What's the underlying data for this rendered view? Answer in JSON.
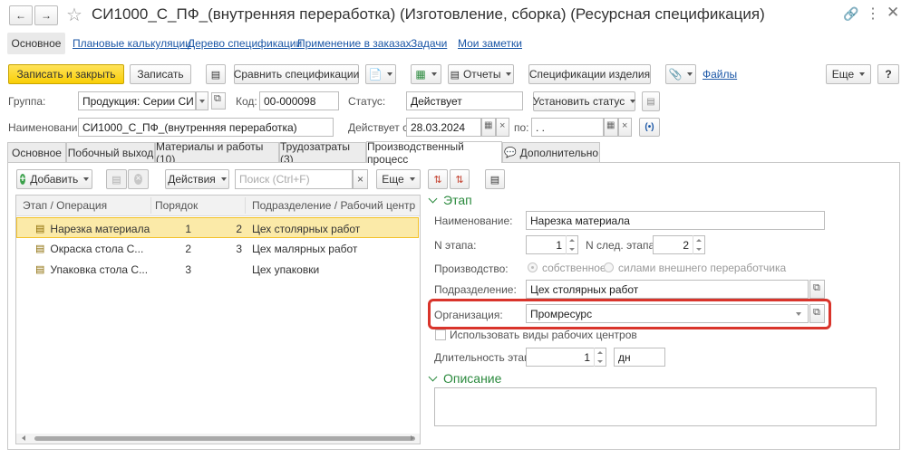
{
  "window": {
    "title": "СИ1000_С_ПФ_(внутренняя переработка) (Изготовление, сборка) (Ресурсная спецификация)"
  },
  "nav": {
    "items": [
      "Основное",
      "Плановые калькуляции",
      "Дерево спецификации",
      "Применение в заказах",
      "Задачи",
      "Мои заметки"
    ]
  },
  "toolbar": {
    "save_close": "Записать и закрыть",
    "save": "Записать",
    "compare": "Сравнить спецификации",
    "reports": "Отчеты",
    "specs_product": "Спецификации изделия",
    "files": "Файлы",
    "more": "Еще",
    "help": "?"
  },
  "header": {
    "group_label": "Группа:",
    "group_value": "Продукция: Серии СИ и Т",
    "code_label": "Код:",
    "code_value": "00-000098",
    "status_label": "Статус:",
    "status_value": "Действует",
    "set_status": "Установить статус",
    "name_label": "Наименование:",
    "name_value": "СИ1000_С_ПФ_(внутренняя переработка)",
    "valid_from_label": "Действует с:",
    "valid_from_value": "28.03.2024",
    "to_label": "по:",
    "to_value": " .  .",
    "range_icon_text": "(•)"
  },
  "tabs": [
    "Основное",
    "Побочный выход",
    "Материалы и работы (10)",
    "Трудозатраты (3)",
    "Производственный процесс",
    "Дополнительно"
  ],
  "stage_toolbar": {
    "add": "Добавить",
    "actions": "Действия",
    "search_placeholder": "Поиск (Ctrl+F)",
    "clear": "×",
    "more": "Еще"
  },
  "table": {
    "columns": [
      "Этап / Операция",
      "Порядок",
      "Подразделение / Рабочий центр"
    ],
    "rows": [
      {
        "stage": "Нарезка материала",
        "order": "1",
        "next": "2",
        "dept": "Цех столярных работ"
      },
      {
        "stage": "Окраска стола С...",
        "order": "2",
        "next": "3",
        "dept": "Цех малярных работ"
      },
      {
        "stage": "Упаковка стола С...",
        "order": "3",
        "next": "",
        "dept": "Цех упаковки"
      }
    ]
  },
  "stage_panel": {
    "section_title": "Этап",
    "name_label": "Наименование:",
    "name_value": "Нарезка материала",
    "n_label": "N этапа:",
    "n_value": "1",
    "next_label": "N след. этапа:",
    "next_value": "2",
    "production_label": "Производство:",
    "option_own": "собственное",
    "option_external": "силами внешнего переработчика",
    "dept_label": "Подразделение:",
    "dept_value": "Цех столярных работ",
    "org_label": "Организация:",
    "org_value": "Промресурс",
    "use_wc_types": "Использовать виды рабочих центров",
    "duration_label": "Длительность этапа:",
    "duration_value": "1",
    "duration_unit": "дн",
    "description_title": "Описание"
  },
  "colors": {
    "accent_yellow": "#f9d93b",
    "row_selected": "#fbeaa8",
    "section_green": "#2b8a3e",
    "highlight_red": "#d9342b",
    "link_blue": "#1a56a6"
  }
}
